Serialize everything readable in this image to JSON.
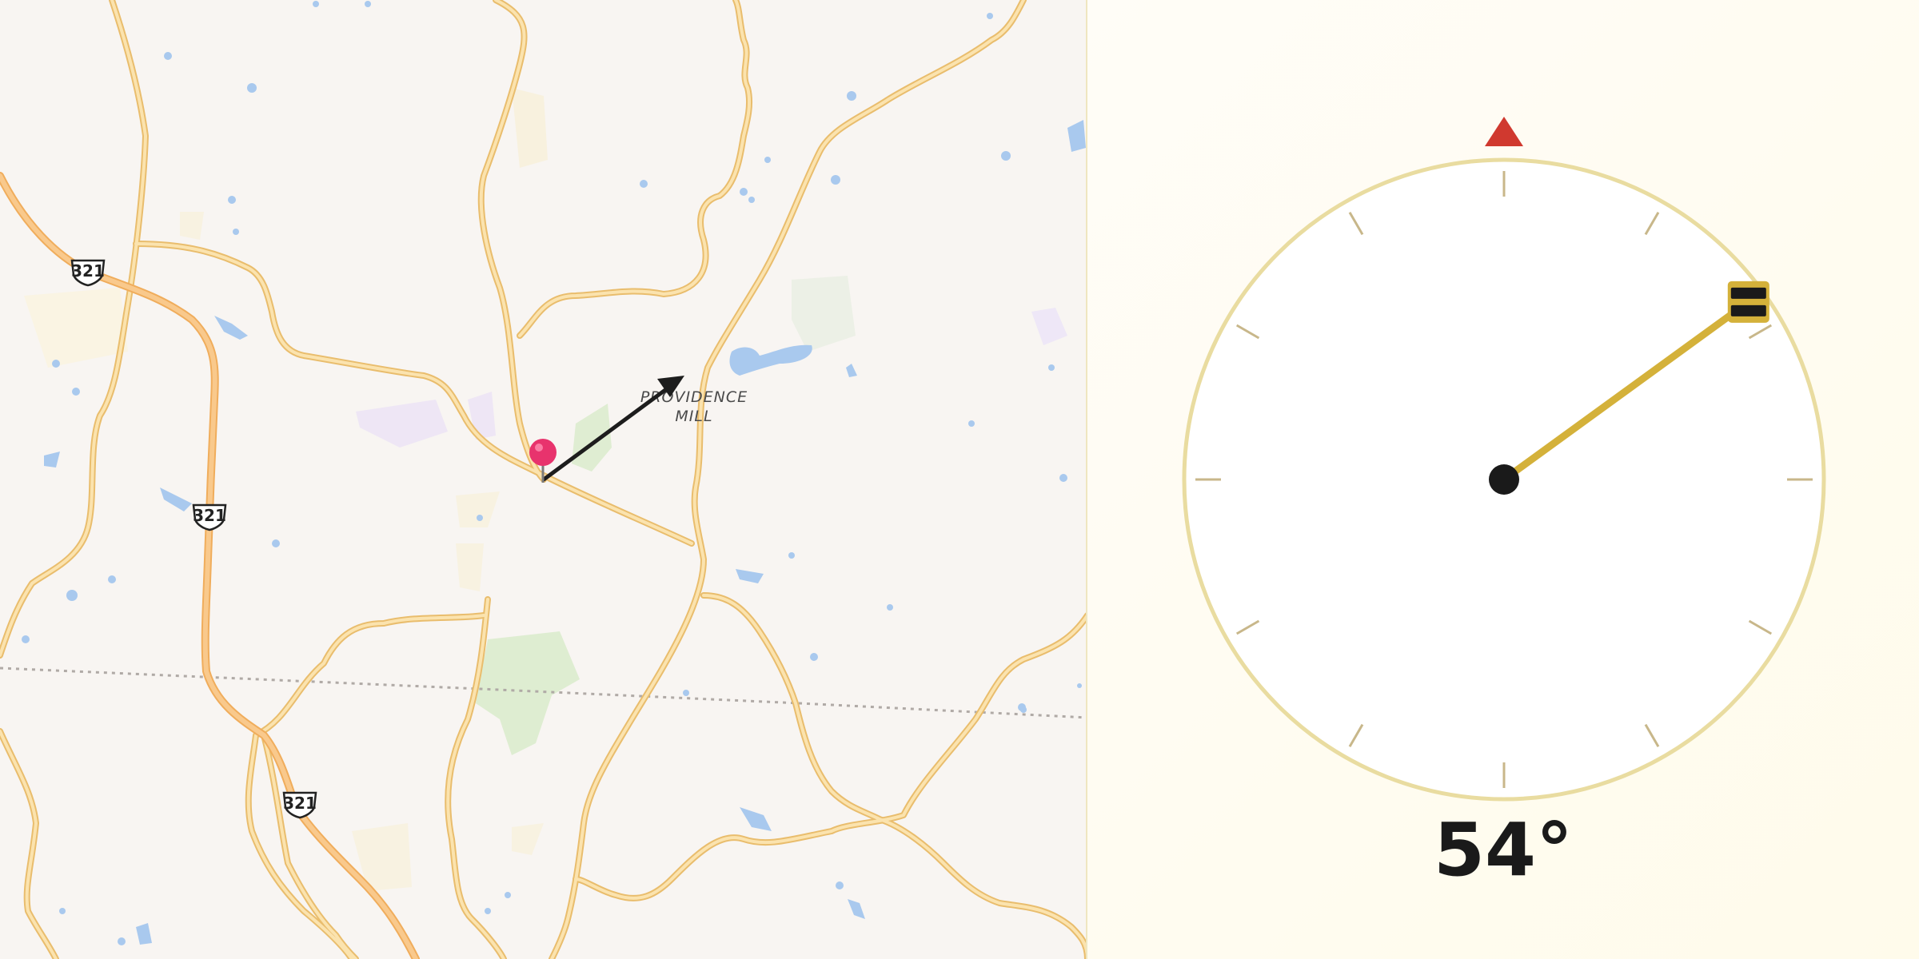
{
  "map": {
    "place_label_line1": "PROVIDENCE",
    "place_label_line2": "MILL",
    "route_shields": [
      "321",
      "321",
      "321"
    ],
    "pin_color": "#e8336d",
    "road_color": "#f6cf86",
    "highway_color": "#f4b96f",
    "water_color": "#a9c9ee",
    "park_color": "#d8ebc9",
    "rail_color": "#b0aaa6"
  },
  "compass": {
    "heading_degrees": 54,
    "heading_text": "54°",
    "north_marker_color": "#d0392f",
    "needle_color": "#d4b13a",
    "dial_ring_color": "#e9dca0",
    "tick_color": "#c8b78a"
  }
}
